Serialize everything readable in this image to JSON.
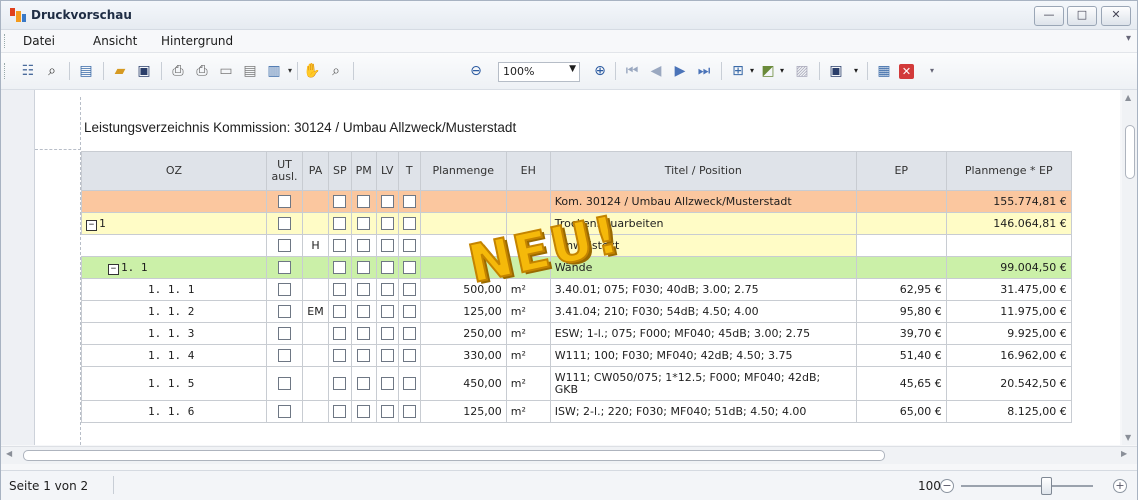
{
  "window": {
    "title": "Druckvorschau",
    "minimize": "—",
    "maximize": "□",
    "close": "✕"
  },
  "menu": [
    "Datei",
    "Ansicht",
    "Hintergrund"
  ],
  "toolbar": {
    "zoom_value": "100%"
  },
  "document": {
    "heading": "Leistungsverzeichnis Kommission: 30124 / Umbau Allzweck/Musterstadt"
  },
  "table": {
    "columns": {
      "oz": "OZ",
      "ut1": "UT",
      "ut2": "ausl.",
      "pa": "PA",
      "sp": "SP",
      "pm": "PM",
      "lv": "LV",
      "t": "T",
      "planmenge": "Planmenge",
      "eh": "EH",
      "titel": "Titel / Position",
      "ep": "EP",
      "gesamt": "Planmenge * EP"
    },
    "rows": [
      {
        "oz": "",
        "pa": "",
        "planmenge": "",
        "eh": "",
        "titel": "Kom. 30124 / Umbau Allzweck/Musterstadt",
        "ep": "",
        "gesamt": "155.774,81 €"
      },
      {
        "toggle": "−",
        "oz": "1",
        "pa": "",
        "planmenge": "",
        "eh": "",
        "titel": "Trockenbauarbeiten",
        "ep": "",
        "gesamt": "146.064,81 €"
      },
      {
        "oz": "",
        "pa": "H",
        "planmenge": "",
        "eh": "",
        "titel": "Hinweistext",
        "ep": "",
        "gesamt": ""
      },
      {
        "toggle": "−",
        "oz": "1. 1",
        "pa": "",
        "planmenge": "",
        "eh": "",
        "titel": "Wände",
        "ep": "",
        "gesamt": "99.004,50 €"
      },
      {
        "oz": "1. 1.  1",
        "pa": "",
        "planmenge": "500,00",
        "eh": "m²",
        "titel": "3.40.01; 075; F030; 40dB; 3.00; 2.75",
        "ep": "62,95 €",
        "gesamt": "31.475,00 €"
      },
      {
        "oz": "1. 1.  2",
        "pa": "EM",
        "planmenge": "125,00",
        "eh": "m²",
        "titel": "3.41.04; 210; F030; 54dB; 4.50; 4.00",
        "ep": "95,80 €",
        "gesamt": "11.975,00 €"
      },
      {
        "oz": "1. 1.  3",
        "pa": "",
        "planmenge": "250,00",
        "eh": "m²",
        "titel": "ESW; 1-l.; 075; F000; MF040; 45dB; 3.00; 2.75",
        "ep": "39,70 €",
        "gesamt": "9.925,00 €"
      },
      {
        "oz": "1. 1.  4",
        "pa": "",
        "planmenge": "330,00",
        "eh": "m²",
        "titel": "W111; 100; F030; MF040; 42dB; 4.50; 3.75",
        "ep": "51,40 €",
        "gesamt": "16.962,00 €"
      },
      {
        "oz": "1. 1.  5",
        "pa": "",
        "planmenge": "450,00",
        "eh": "m²",
        "titel": "W111; CW050/075; 1*12.5; F000; MF040; 42dB;",
        "titel2": "GKB",
        "ep": "45,65 €",
        "gesamt": "20.542,50 €"
      },
      {
        "oz": "1. 1.  6",
        "pa": "",
        "planmenge": "125,00",
        "eh": "m²",
        "titel": "ISW; 2-l.; 220; F030; MF040; 51dB; 4.50; 4.00",
        "ep": "65,00 €",
        "gesamt": "8.125,00 €"
      }
    ]
  },
  "overlay": {
    "stamp": "NEU!"
  },
  "status": {
    "pages": "Seite 1 von 2",
    "zoom": "100%",
    "zoom_out": "−",
    "zoom_in": "+"
  },
  "colors": {
    "orange_row": "#fbc79f",
    "yellow_row": "#fffcc6",
    "green_row": "#cbf0a8",
    "stamp": "#f5b90a"
  }
}
